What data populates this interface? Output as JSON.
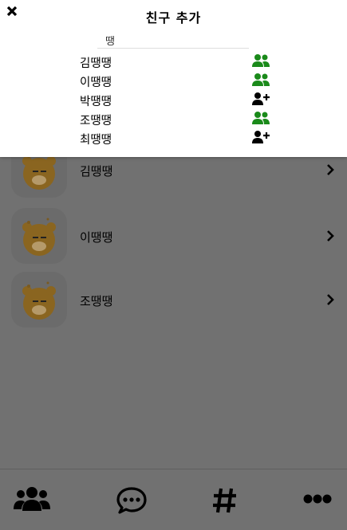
{
  "modal": {
    "title": "친구 추가",
    "search": {
      "value": "땡",
      "placeholder": ""
    },
    "results": [
      {
        "name": "김땡땡",
        "status": "friend",
        "icon": "user-friends-icon",
        "color": "#1a8a1a"
      },
      {
        "name": "이땡땡",
        "status": "friend",
        "icon": "user-friends-icon",
        "color": "#1a8a1a"
      },
      {
        "name": "박땡땡",
        "status": "add",
        "icon": "user-plus-icon",
        "color": "#000000"
      },
      {
        "name": "조땡땡",
        "status": "friend",
        "icon": "user-friends-icon",
        "color": "#1a8a1a"
      },
      {
        "name": "최땡땡",
        "status": "add",
        "icon": "user-plus-icon",
        "color": "#000000"
      }
    ]
  },
  "friends": [
    {
      "name": "김땡땡",
      "avatar": "bear-avatar"
    },
    {
      "name": "이땡땡",
      "avatar": "bear-avatar"
    },
    {
      "name": "조땡땡",
      "avatar": "bear-avatar"
    }
  ],
  "nav": [
    {
      "name": "friends",
      "icon": "users-icon"
    },
    {
      "name": "chats",
      "icon": "comment-dots-icon"
    },
    {
      "name": "hashtag",
      "icon": "hashtag-icon"
    },
    {
      "name": "more",
      "icon": "ellipsis-icon"
    }
  ],
  "colors": {
    "overlay": "#717171",
    "friend_green": "#1a8a1a",
    "modal_bg": "#ffffff"
  }
}
